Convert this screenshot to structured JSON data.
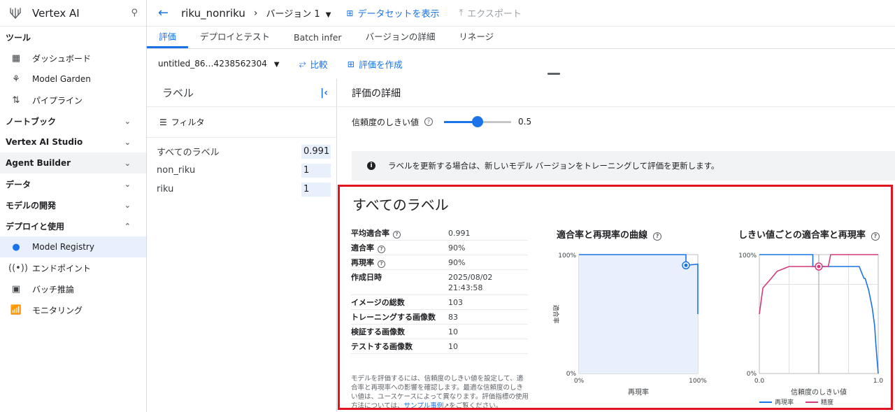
{
  "sidebar": {
    "title": "Vertex AI",
    "sections": [
      {
        "label": "ツール",
        "items": [
          {
            "label": "ダッシュボード",
            "icon": "dashboard-icon"
          },
          {
            "label": "Model Garden",
            "icon": "sprout-icon"
          },
          {
            "label": "パイプライン",
            "icon": "pipeline-icon"
          }
        ]
      },
      {
        "label": "ノートブック"
      },
      {
        "label": "Vertex AI Studio"
      },
      {
        "label": "Agent Builder"
      },
      {
        "label": "データ"
      },
      {
        "label": "モデルの開発"
      },
      {
        "label": "デプロイと使用",
        "items": [
          {
            "label": "Model Registry",
            "icon": "bulb-icon"
          },
          {
            "label": "エンドポイント",
            "icon": "broadcast-icon"
          },
          {
            "label": "バッチ推論",
            "icon": "batch-icon"
          },
          {
            "label": "モニタリング",
            "icon": "chart-icon"
          }
        ]
      }
    ]
  },
  "topbar": {
    "model_name": "riku_nonriku",
    "version": "バージョン 1",
    "dataset_link": "データセットを表示",
    "export": "エクスポート"
  },
  "tabs": [
    "評価",
    "デプロイとテスト",
    "Batch infer",
    "バージョンの詳細",
    "リネージ"
  ],
  "toolbar": {
    "evaluation": "untitled_86…4238562304",
    "compare": "比較",
    "create_eval": "評価を作成"
  },
  "labels_panel": {
    "title": "ラベル",
    "filter": "フィルタ",
    "rows": [
      {
        "name": "すべてのラベル",
        "value": "0.991"
      },
      {
        "name": "non_riku",
        "value": "1"
      },
      {
        "name": "riku",
        "value": "1"
      }
    ]
  },
  "details": {
    "title": "評価の詳細",
    "threshold_label": "信頼度のしきい値",
    "threshold_value": "0.5",
    "threshold_fraction": 0.5,
    "info": "ラベルを更新する場合は、新しいモデル バージョンをトレーニングして評価を更新します。"
  },
  "summary": {
    "title": "すべてのラベル",
    "metrics": [
      {
        "key": "平均適合率",
        "value": "0.991",
        "help": true
      },
      {
        "key": "適合率",
        "value": "90%",
        "help": true
      },
      {
        "key": "再現率",
        "value": "90%",
        "help": true
      },
      {
        "key": "作成日時",
        "value": "2025/08/02 21:43:58",
        "help": false
      },
      {
        "key": "イメージの総数",
        "value": "103",
        "help": false
      },
      {
        "key": "トレーニングする画像数",
        "value": "83",
        "help": false
      },
      {
        "key": "検証する画像数",
        "value": "10",
        "help": false
      },
      {
        "key": "テストする画像数",
        "value": "10",
        "help": false
      }
    ],
    "description": "モデルを評価するには、信頼度のしきい値を設定して、適合率と再現率への影響を確認します。最適な信頼度のしきい値は、ユースケースによって異なります。評価指標の使用方法については、",
    "sample_link": "サンプル事例",
    "description_tail": "をご覧ください。"
  },
  "chart_data": [
    {
      "type": "line",
      "title": "適合率と再現率の曲線",
      "xlabel": "再現率",
      "ylabel": "適合率",
      "x_ticks": [
        "0%",
        "100%"
      ],
      "y_ticks": [
        "0%",
        "100%"
      ],
      "xlim": [
        0,
        1
      ],
      "ylim": [
        0,
        1
      ],
      "series": [
        {
          "x": [
            0.0,
            0.9,
            0.9,
            0.9,
            1.0,
            1.0
          ],
          "y": [
            1.0,
            1.0,
            1.0,
            0.91,
            0.92,
            0.5
          ]
        }
      ],
      "marker": {
        "x": 0.9,
        "y": 0.91
      },
      "area_fill": true
    },
    {
      "type": "line",
      "title": "しきい値ごとの適合率と再現率",
      "xlabel": "信頼度のしきい値",
      "x_ticks": [
        "0.0",
        "1.0"
      ],
      "y_ticks": [
        "0%",
        "100%"
      ],
      "xlim": [
        0,
        1
      ],
      "ylim": [
        0,
        1
      ],
      "vline": 0.5,
      "series": [
        {
          "name": "再現率",
          "color": "#1a73e8",
          "x": [
            0.0,
            0.45,
            0.45,
            0.5,
            0.84,
            0.86,
            0.88,
            0.89,
            0.92,
            0.94,
            0.95,
            0.97,
            0.98,
            0.99,
            1.0
          ],
          "y": [
            1.0,
            1.0,
            0.9,
            0.9,
            0.9,
            0.85,
            0.8,
            0.8,
            0.7,
            0.6,
            0.55,
            0.4,
            0.25,
            0.12,
            0.0
          ]
        },
        {
          "name": "精度",
          "color": "#d23a7c",
          "x": [
            0.0,
            0.03,
            0.1,
            0.15,
            0.25,
            0.5,
            0.58,
            0.6,
            1.0
          ],
          "y": [
            0.5,
            0.72,
            0.8,
            0.86,
            0.9,
            0.9,
            0.9,
            1.0,
            1.0
          ]
        }
      ],
      "marker": {
        "x": 0.5,
        "y": 0.9
      }
    }
  ]
}
